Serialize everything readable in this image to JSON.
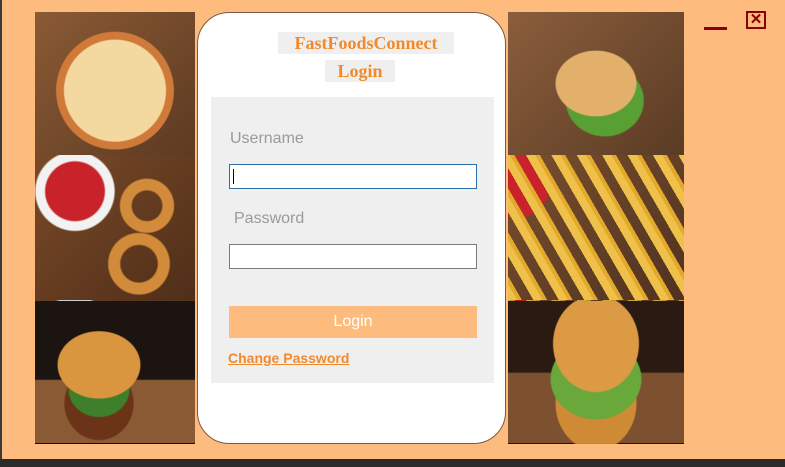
{
  "app": {
    "title": "FastFoodsConnect",
    "screen_title": "Login"
  },
  "form": {
    "username_label": "Username",
    "username_value": "",
    "password_label": "Password",
    "password_value": "",
    "login_button": "Login",
    "change_password_link": "Change Password"
  },
  "window_controls": {
    "minimize": "minimize-icon",
    "close_glyph": "✕"
  },
  "colors": {
    "background": "#fdbc7d",
    "accent": "#f28a2c",
    "panel": "#efefef",
    "controls": "#8b0000"
  }
}
